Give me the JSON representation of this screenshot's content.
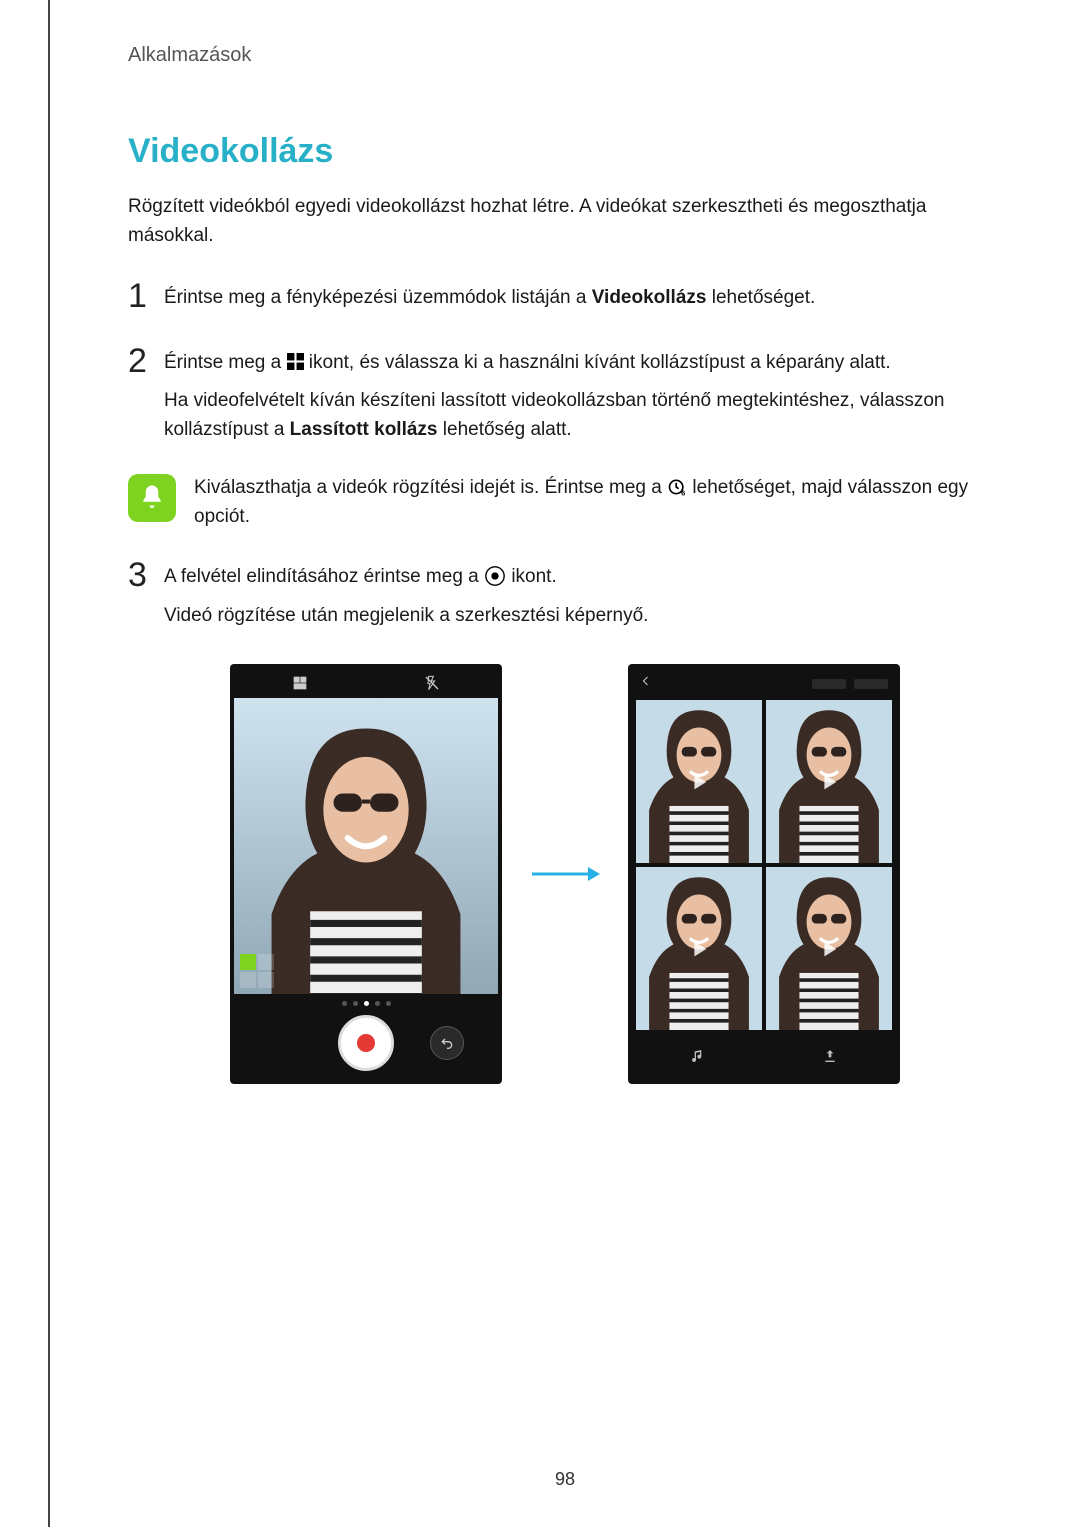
{
  "breadcrumb": "Alkalmazások",
  "title": "Videokollázs",
  "intro": "Rögzített videókból egyedi videokollázst hozhat létre. A videókat szerkesztheti és megoszthatja másokkal.",
  "steps": {
    "1": {
      "pre": "Érintse meg a fényképezési üzemmódok listáján a ",
      "bold": "Videokollázs",
      "post": " lehetőséget."
    },
    "2": {
      "p1_pre": "Érintse meg a ",
      "p1_post": " ikont, és válassza ki a használni kívánt kollázstípust a képarány alatt.",
      "p2_pre": "Ha videofelvételt kíván készíteni lassított videokollázsban történő megtekintéshez, válasszon kollázstípust a ",
      "p2_bold": "Lassított kollázs",
      "p2_post": " lehetőség alatt."
    },
    "3": {
      "p1_pre": "A felvétel elindításához érintse meg a ",
      "p1_post": " ikont.",
      "p2": "Videó rögzítése után megjelenik a szerkesztési képernyő."
    }
  },
  "note": {
    "pre": "Kiválaszthatja a videók rögzítési idejét is. Érintse meg a ",
    "post": " lehetőséget, majd válasszon egy opciót."
  },
  "page_number": "98"
}
